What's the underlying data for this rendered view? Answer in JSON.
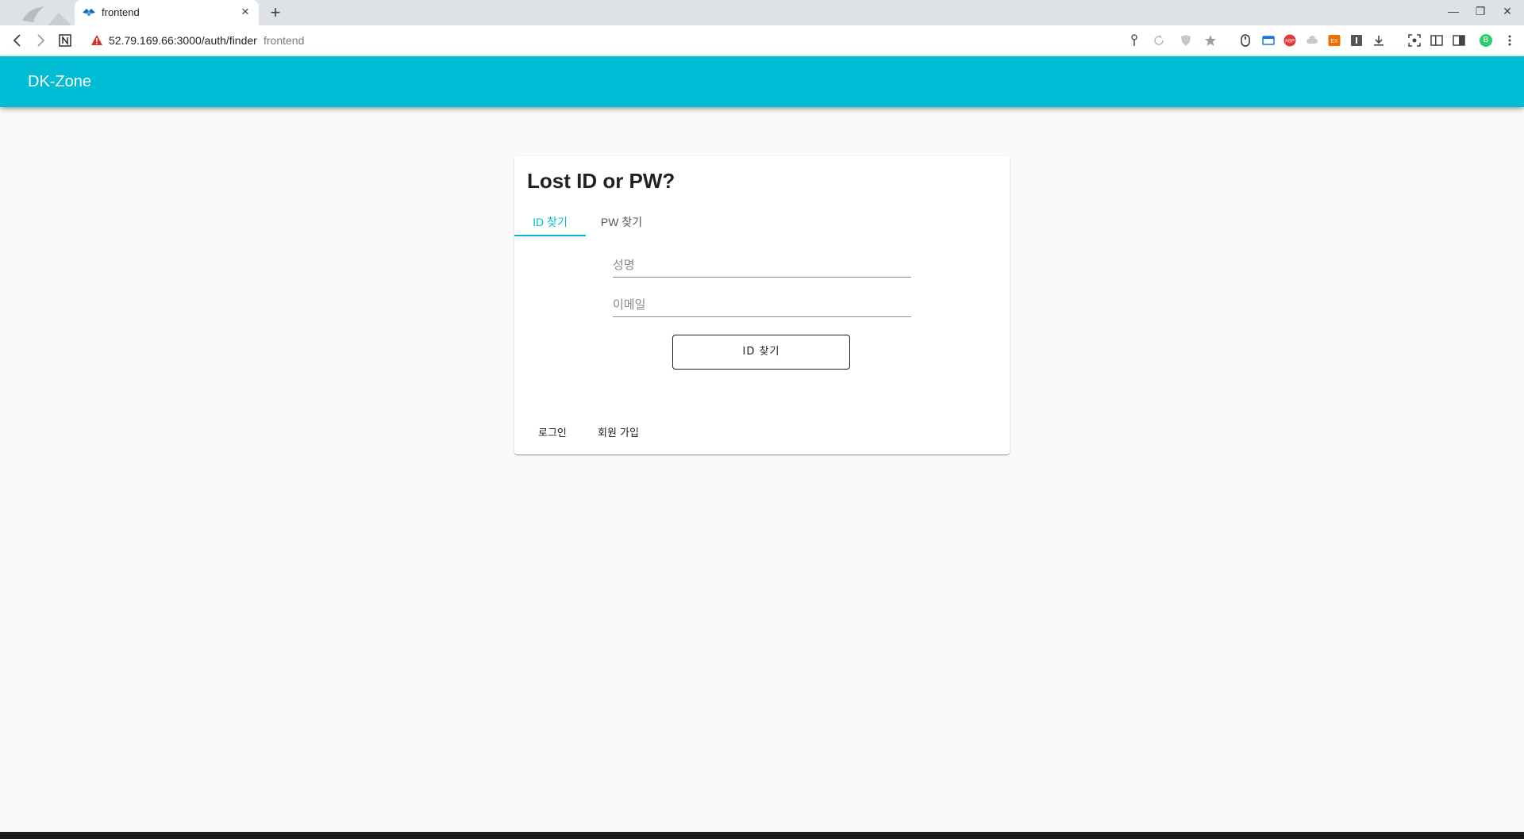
{
  "browser": {
    "tab_title": "frontend",
    "new_tab": "+",
    "close_tab": "×",
    "url_host": "52.79.169.66:3000/auth/finder",
    "url_page_title": "frontend",
    "window_controls": [
      "—",
      "❐",
      "✕"
    ],
    "extension_icons": [
      "key-icon",
      "refresh-icon",
      "shield-icon",
      "star-icon",
      "mouse-icon",
      "window-icon",
      "adblock-icon",
      "cloud-icon",
      "ex-icon",
      "reader-icon",
      "download-icon",
      "screenshot-icon",
      "sidebar-icon",
      "split-icon",
      "profile-icon",
      "menu-icon"
    ],
    "profile_initial": "B"
  },
  "appbar": {
    "brand": "DK-Zone",
    "color": "#00bcd4"
  },
  "card": {
    "title": "Lost ID or PW?",
    "tabs": [
      {
        "label": "ID 찾기",
        "active": true
      },
      {
        "label": "PW 찾기",
        "active": false
      }
    ],
    "fields": {
      "name": {
        "placeholder": "성명",
        "value": ""
      },
      "email": {
        "placeholder": "이메일",
        "value": ""
      }
    },
    "submit_label": "ID 찾기",
    "links": {
      "login": "로그인",
      "signup": "회원 가입"
    }
  }
}
